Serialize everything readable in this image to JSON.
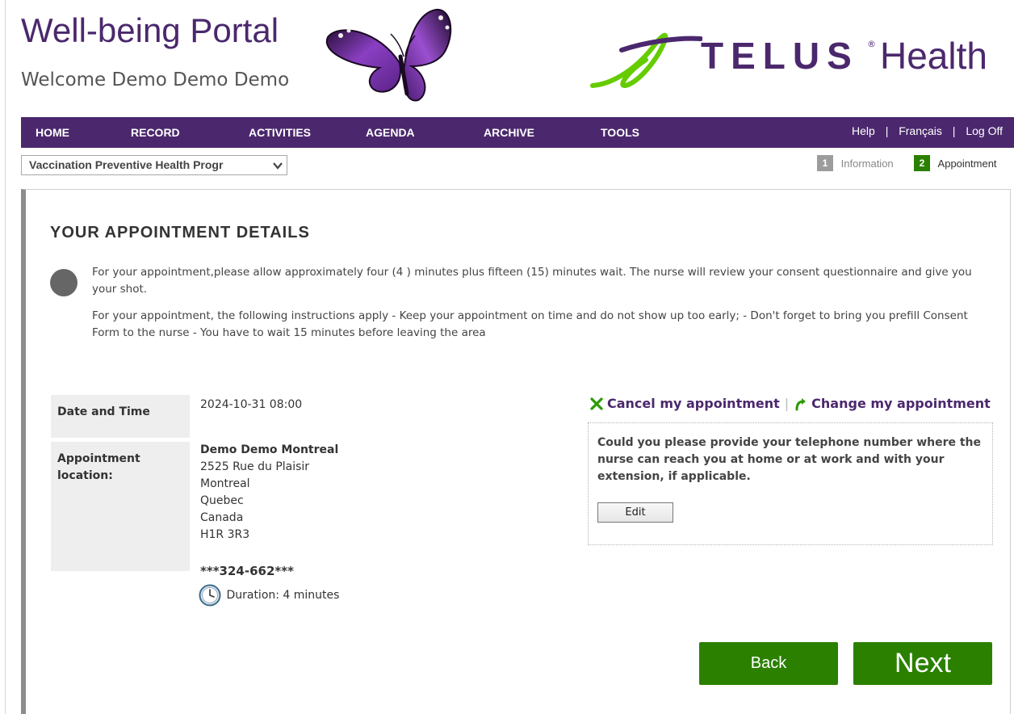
{
  "header": {
    "portal_title": "Well-being Portal",
    "welcome": "Welcome Demo Demo Demo",
    "brand_name": "TELUS",
    "brand_suffix": "Health",
    "brand_reg": "®",
    "brand_color": "#4b286d",
    "brand_accent": "#66cc00",
    "icons": [
      "butterfly-logo-icon",
      "telus-mark-icon"
    ]
  },
  "nav": {
    "items": [
      {
        "label": "HOME"
      },
      {
        "label": "RECORD"
      },
      {
        "label": "ACTIVITIES"
      },
      {
        "label": "AGENDA"
      },
      {
        "label": "ARCHIVE"
      },
      {
        "label": "TOOLS"
      }
    ],
    "help": "Help",
    "language": "Français",
    "logoff": "Log Off",
    "separator": "|",
    "bg_color": "#4b286d"
  },
  "program": {
    "selected": "Vaccination Preventive Health Progr",
    "icon": "chevron-down-icon"
  },
  "steps": [
    {
      "number": "1",
      "label": "Information",
      "active": false
    },
    {
      "number": "2",
      "label": "Appointment",
      "active": true
    }
  ],
  "content": {
    "title": "YOUR APPOINTMENT DETAILS",
    "info_icon": "info-dot-icon",
    "info_1": "For your appointment,please allow approximately four (4 ) minutes plus fifteen (15) minutes wait. The nurse will review your consent questionnaire and give you your shot.",
    "info_2": "For your appointment, the following instructions apply - Keep your appointment on time and do not show up too early; - Don't forget to bring you prefill Consent Form to the nurse - You have to wait 15 minutes before leaving the area",
    "date_label": "Date and Time",
    "date_value": "2024-10-31 08:00",
    "location_label": "Appointment location:",
    "location": {
      "name": "Demo Demo Montreal",
      "street": "2525 Rue du Plaisir",
      "city": "Montreal",
      "province": "Quebec",
      "country": "Canada",
      "postal": "H1R 3R3"
    },
    "phone": "***324-662***",
    "duration": "Duration: 4 minutes",
    "duration_icon": "clock-icon",
    "cancel_label": "Cancel my appointment",
    "cancel_icon": "cross-icon",
    "change_label": "Change my appointment",
    "change_icon": "redo-arrow-icon",
    "action_separator": "|",
    "phone_prompt": "Could you please provide your telephone number where the nurse can reach you at home or at work and with your extension, if applicable.",
    "edit_label": "Edit",
    "back_label": "Back",
    "next_label": "Next",
    "button_color": "#2b8000"
  }
}
